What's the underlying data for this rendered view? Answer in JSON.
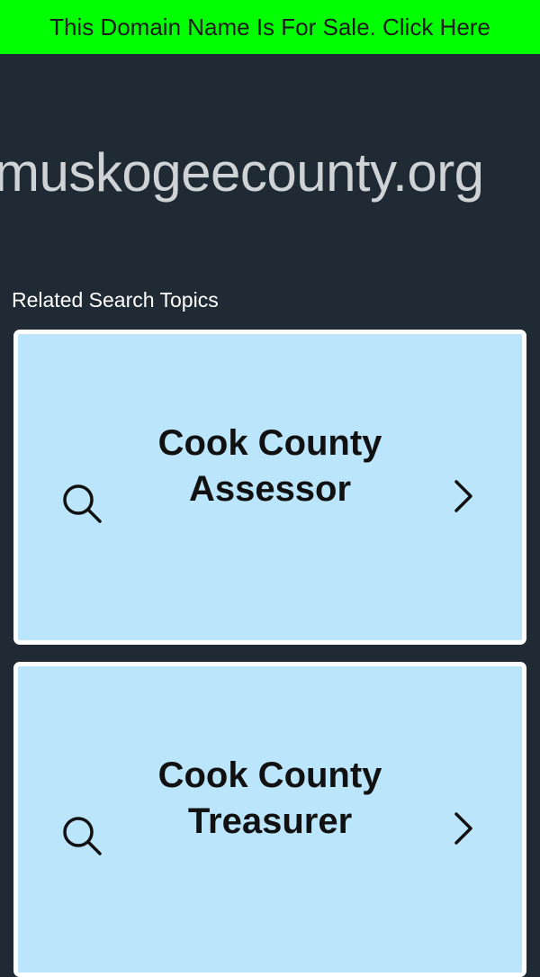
{
  "banner": {
    "text": "This Domain Name Is For Sale. Click Here",
    "background": "#00ff00"
  },
  "header": {
    "domain": "muskogeecounty.org"
  },
  "related": {
    "heading": "Related Search Topics",
    "card_color": "#bbe5fb",
    "topics": [
      {
        "label": "Cook County Assessor",
        "left_icon": "search-icon",
        "right_icon": "chevron-right-icon"
      },
      {
        "label": "Cook County Treasurer",
        "left_icon": "search-icon",
        "right_icon": "chevron-right-icon"
      }
    ]
  }
}
